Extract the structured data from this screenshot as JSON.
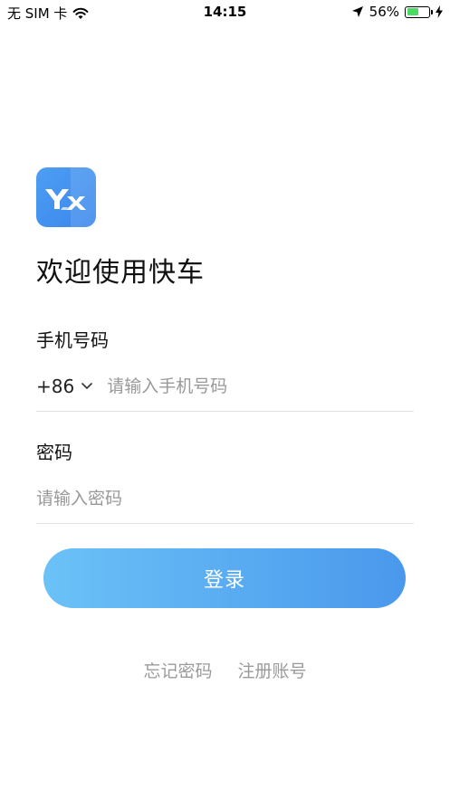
{
  "status_bar": {
    "carrier": "无 SIM 卡",
    "time": "14:15",
    "battery_percent": "56%",
    "battery_level": 0.56,
    "icons": [
      "wifi-icon",
      "location-arrow-icon",
      "battery-icon",
      "charging-icon"
    ]
  },
  "app": {
    "logo_text": "YX",
    "welcome": "欢迎使用快车",
    "brand_color": "#4a98ec"
  },
  "form": {
    "phone_label": "手机号码",
    "country_code": "+86",
    "phone_placeholder": "请输入手机号码",
    "phone_value": "",
    "password_label": "密码",
    "password_placeholder": "请输入密码",
    "password_value": "",
    "login_label": "登录"
  },
  "links": {
    "forgot_password": "忘记密码",
    "register": "注册账号"
  }
}
